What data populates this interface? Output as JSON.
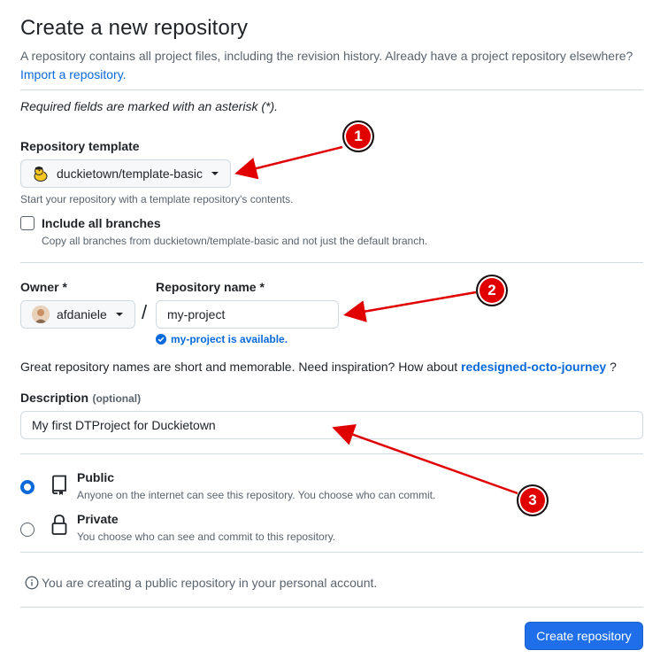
{
  "header": {
    "title": "Create a new repository",
    "subtitle": "A repository contains all project files, including the revision history. Already have a project repository elsewhere?",
    "import_link": "Import a repository."
  },
  "required_note": "Required fields are marked with an asterisk (*).",
  "template": {
    "label": "Repository template",
    "selected": "duckietown/template-basic",
    "note": "Start your repository with a template repository's contents.",
    "include_branches_label": "Include all branches",
    "include_branches_note": "Copy all branches from duckietown/template-basic and not just the default branch."
  },
  "owner": {
    "label": "Owner *",
    "selected": "afdaniele"
  },
  "separator": "/",
  "repo_name": {
    "label": "Repository name *",
    "value": "my-project",
    "availability": "my-project is available."
  },
  "inspiration": {
    "text": "Great repository names are short and memorable. Need inspiration? How about",
    "suggestion": "redesigned-octo-journey",
    "tail": "?"
  },
  "description": {
    "label": "Description",
    "optional": "(optional)",
    "value": "My first DTProject for Duckietown"
  },
  "visibility": {
    "public_label": "Public",
    "public_note": "Anyone on the internet can see this repository. You choose who can commit.",
    "private_label": "Private",
    "private_note": "You choose who can see and commit to this repository.",
    "selected": "Public"
  },
  "info_note": "You are creating a public repository in your personal account.",
  "create_button": "Create repository",
  "annotations": {
    "marker1": "1",
    "marker2": "2",
    "marker3": "3"
  },
  "colors": {
    "link": "#0969da",
    "primary_button": "#1f6feb",
    "annotation_red": "#e00000",
    "success": "#1a7f37"
  }
}
